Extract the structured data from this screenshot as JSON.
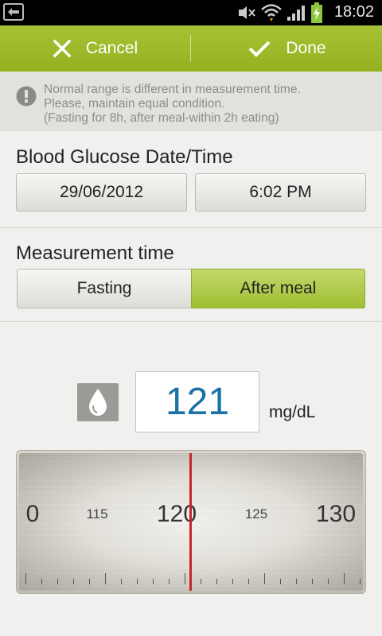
{
  "status_bar": {
    "time": "18:02",
    "icons": [
      "back-icon",
      "mute-icon",
      "wifi-icon",
      "signal-icon",
      "battery-charging-icon"
    ]
  },
  "action_bar": {
    "cancel_label": "Cancel",
    "done_label": "Done",
    "accent_color": "#9bb928"
  },
  "info": {
    "icon": "info-icon",
    "line1": "Normal range is different in measurement time.",
    "line2": "Please, maintain equal condition.",
    "line3": "(Fasting for 8h, after meal-within 2h eating)"
  },
  "datetime": {
    "title": "Blood Glucose Date/Time",
    "date": "29/06/2012",
    "time": "6:02 PM"
  },
  "measurement": {
    "title": "Measurement time",
    "options": [
      "Fasting",
      "After meal"
    ],
    "selected": "After meal"
  },
  "reading": {
    "icon": "blood-drop-icon",
    "value": "121",
    "unit": "mg/dL",
    "value_color": "#1a72a8"
  },
  "ruler": {
    "labels": [
      "0",
      "115",
      "120",
      "125",
      "130"
    ],
    "current": 121,
    "indicator_color": "#c4262b"
  }
}
